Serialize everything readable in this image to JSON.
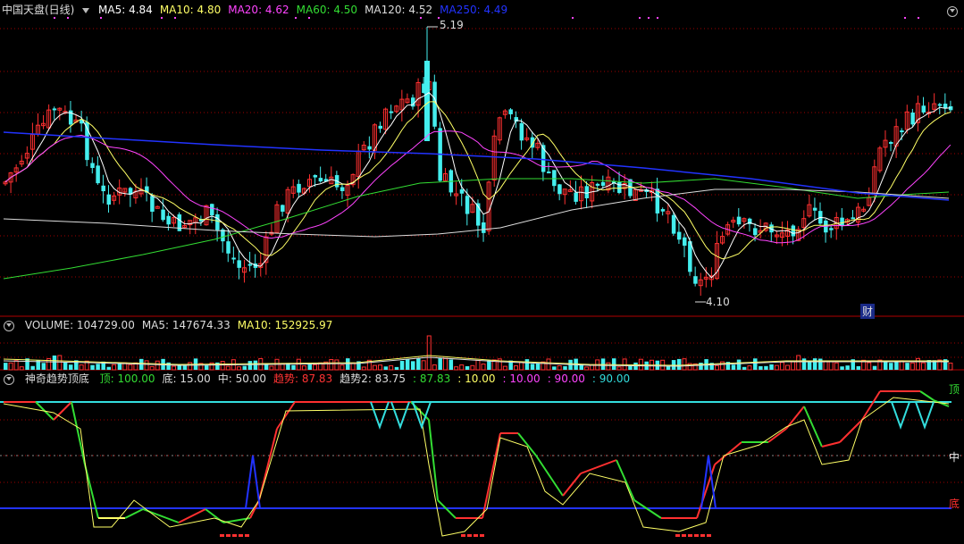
{
  "main_panel": {
    "title": "中国天盘(日线)",
    "ma": [
      {
        "label": "MA5: 4.84",
        "color": "#ffffff"
      },
      {
        "label": "MA10: 4.80",
        "color": "#ffff66"
      },
      {
        "label": "MA20: 4.62",
        "color": "#ff44ff"
      },
      {
        "label": "MA60: 4.50",
        "color": "#33dd33"
      },
      {
        "label": "MA120: 4.52",
        "color": "#dddddd"
      },
      {
        "label": "MA250: 4.49",
        "color": "#2233ff"
      }
    ],
    "high_label": "5.19",
    "low_label": "4.10",
    "finance_marker": "财"
  },
  "volume_panel": {
    "items": [
      {
        "label": "VOLUME: 104729.00",
        "color": "#dddddd"
      },
      {
        "label": "MA5: 147674.33",
        "color": "#dddddd"
      },
      {
        "label": "MA10: 152925.97",
        "color": "#ffff66"
      }
    ]
  },
  "indicator_panel": {
    "title": "神奇趋势顶底",
    "items": [
      {
        "label": "顶: 100.00",
        "color": "#33dd33"
      },
      {
        "label": "底: 15.00",
        "color": "#dddddd"
      },
      {
        "label": "中: 50.00",
        "color": "#dddddd"
      },
      {
        "label": "趋势: 87.83",
        "color": "#ff3333"
      },
      {
        "label": "趋势2: 83.75",
        "color": "#dddddd"
      },
      {
        "label": ": 87.83",
        "color": "#33dd33"
      },
      {
        "label": ": 10.00",
        "color": "#ffff66"
      },
      {
        "label": ": 10.00",
        "color": "#ff44ff"
      },
      {
        "label": ": 90.00",
        "color": "#ff44ff"
      },
      {
        "label": ": 90.00",
        "color": "#33dddd"
      }
    ],
    "top_label": "顶",
    "mid_label": "中",
    "bottom_label": "底"
  },
  "colors": {
    "up": "#ff3030",
    "down": "#44eeee",
    "grid_red": "#a00000"
  }
}
